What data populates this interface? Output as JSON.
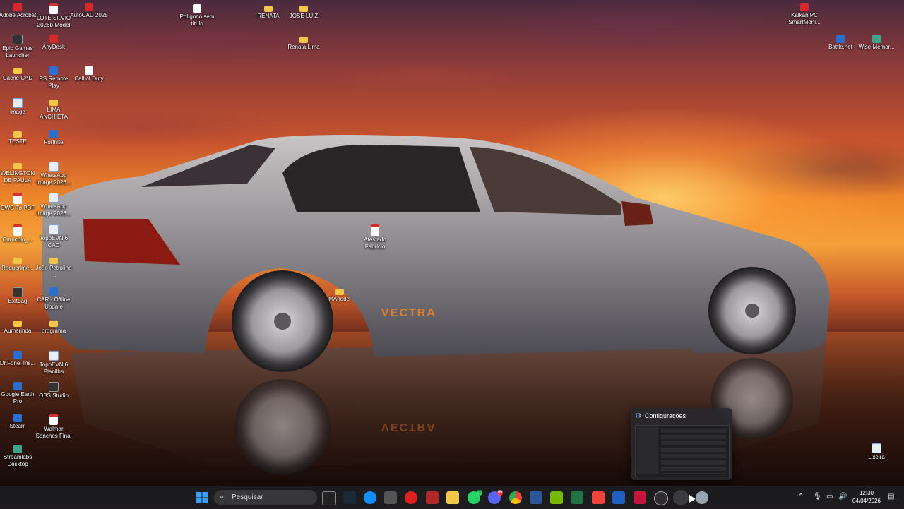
{
  "desktop": {
    "icons": [
      {
        "label": "Adobe Acrobat",
        "icon": "acrobat-icon"
      },
      {
        "label": "LOTE SILVIO 2026b-Model",
        "icon": "pdf-icon"
      },
      {
        "label": "AutoCAD 2025",
        "icon": "autocad-icon"
      },
      {
        "label": "Polígono sem título",
        "icon": "wifi-file-icon"
      },
      {
        "label": "RENATA",
        "icon": "folder-icon"
      },
      {
        "label": "JOSE LUIZ",
        "icon": "folder-icon"
      },
      {
        "label": "Renata Lima",
        "icon": "folder-icon"
      },
      {
        "label": "Epic Games Launcher",
        "icon": "epic-icon"
      },
      {
        "label": "AnyDesk",
        "icon": "anydesk-icon"
      },
      {
        "label": "Cache CAD",
        "icon": "folder-icon"
      },
      {
        "label": "PS Remote Play",
        "icon": "ps-remote-icon"
      },
      {
        "label": "Call of Duty",
        "icon": "document-icon"
      },
      {
        "label": "image",
        "icon": "image-icon"
      },
      {
        "label": "LIMA ANCHIETA",
        "icon": "folder-icon"
      },
      {
        "label": "TESTE",
        "icon": "folder-icon"
      },
      {
        "label": "Fortnite",
        "icon": "fortnite-icon"
      },
      {
        "label": "WELINGTON DE PAULA",
        "icon": "folder-icon"
      },
      {
        "label": "WhatsApp Image 2026...",
        "icon": "image-icon"
      },
      {
        "label": "DWG To PDF",
        "icon": "dwg-pdf-icon"
      },
      {
        "label": "WhatsApp Image 2026...",
        "icon": "image-icon"
      },
      {
        "label": "Curriculo_...",
        "icon": "pdf-icon"
      },
      {
        "label": "TopoEVN 6 CAD",
        "icon": "topoevn-icon"
      },
      {
        "label": "Atestado Fabricio",
        "icon": "pdf-icon"
      },
      {
        "label": "Requerime...",
        "icon": "folder-icon"
      },
      {
        "label": "João Petrolino ...",
        "icon": "folder-icon"
      },
      {
        "label": "ExitLag",
        "icon": "exitlag-icon"
      },
      {
        "label": "CAR - Offline Update",
        "icon": "car-update-icon"
      },
      {
        "label": "MAnodel",
        "icon": "folder-icon"
      },
      {
        "label": "Aumerinda",
        "icon": "folder-icon"
      },
      {
        "label": "programa",
        "icon": "folder-icon"
      },
      {
        "label": "Dr.Fone_Ins...",
        "icon": "drfone-icon"
      },
      {
        "label": "TopoEVN 6 Planilha",
        "icon": "topoevn-icon"
      },
      {
        "label": "Google Earth Pro",
        "icon": "google-earth-icon"
      },
      {
        "label": "OBS Studio",
        "icon": "obs-icon"
      },
      {
        "label": "Steam",
        "icon": "steam-icon"
      },
      {
        "label": "Walmar Sanches Final",
        "icon": "pdf-icon"
      },
      {
        "label": "Streamlabs Desktop",
        "icon": "streamlabs-icon"
      },
      {
        "label": "Kalkan PC SmartMoni...",
        "icon": "kalkan-icon"
      },
      {
        "label": "Battle.net",
        "icon": "battlenet-icon"
      },
      {
        "label": "Wise Memor...",
        "icon": "wise-memory-icon"
      },
      {
        "label": "Lixeira",
        "icon": "recycle-bin-icon"
      }
    ]
  },
  "wallpaper": {
    "car_badge": "VECTRA",
    "car_badge_reflection": "VECTRA"
  },
  "taskbar_preview": {
    "title": "Configurações",
    "icon": "gear-icon"
  },
  "taskbar": {
    "search_placeholder": "Pesquisar",
    "apps": [
      "epic-icon",
      "steam-icon",
      "battlenet-icon",
      "unity-icon",
      "youtube-icon",
      "app-icon",
      "file-explorer-icon",
      "whatsapp-icon",
      "discord-icon",
      "chrome-icon",
      "word-icon",
      "nvidia-icon",
      "excel-icon",
      "anydesk-icon",
      "ps-remote-icon",
      "acrobat-icon",
      "obs-icon",
      "settings-icon",
      "network-icon"
    ],
    "whatsapp_badge": "3",
    "discord_badge": "99"
  },
  "tray": {
    "time": "12:30",
    "date": "04/04/2026"
  },
  "colors": {
    "taskbar": "#1c1c20",
    "folder": "#f2c648",
    "accent": "#2a6fd0"
  }
}
